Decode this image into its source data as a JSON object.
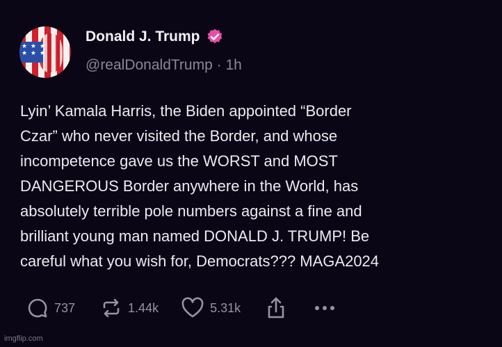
{
  "author": {
    "name": "Donald J. Trump",
    "handle": "@realDonaldTrump",
    "separator": "·",
    "time": "1h",
    "verified_color": "#e64fa5"
  },
  "post": {
    "text": "Lyin’ Kamala Harris, the Biden appointed “Border\nCzar” who never visited the Border, and whose\nincompetence gave us the WORST and MOST\nDANGEROUS Border anywhere in the World, has\nabsolutely terrible pole numbers against a fine and\nbrilliant young man named DONALD J. TRUMP! Be\ncareful what you wish for, Democrats???  MAGA2024"
  },
  "actions": {
    "replies": "737",
    "reposts": "1.44k",
    "likes": "5.31k",
    "reply_icon": "reply-bubble-icon",
    "repost_icon": "repost-arrows-icon",
    "like_icon": "heart-icon",
    "share_icon": "share-icon",
    "more_icon": "more-dots-icon"
  },
  "watermark": "imgflip.com",
  "colors": {
    "background": "#0b0616",
    "text": "#ecebef",
    "muted": "#8c8698"
  }
}
